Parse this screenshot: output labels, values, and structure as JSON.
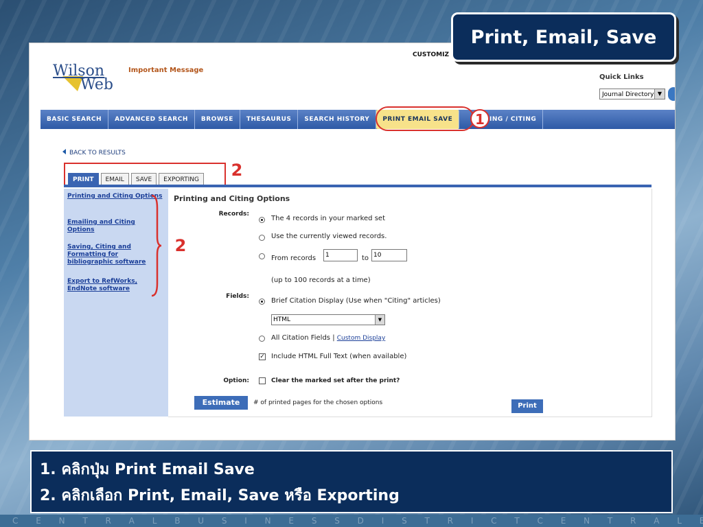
{
  "slide": {
    "title": "Print, Email, Save",
    "caption_lines": [
      "1. คลิกปุ่ม Print Email Save",
      "2. คลิกเลือก Print, Email, Save หรือ Exporting"
    ],
    "bottom_strip": "C E N T R A L B U S I N E S S D I S T R I C T C E N T R A L B U S I N E S S D I S T R I C T C E N T R A"
  },
  "header": {
    "logo_top": "Wilson",
    "logo_bottom": "Web",
    "important_message": "Important Message",
    "customize": "CUSTOMIZ",
    "quick_links_label": "Quick Links",
    "quick_links_value": "Journal Directory"
  },
  "nav": {
    "items": [
      "BASIC SEARCH",
      "ADVANCED SEARCH",
      "BROWSE",
      "THESAURUS",
      "SEARCH HISTORY",
      "PRINT EMAIL SAVE",
      "EXPORTING / CITING"
    ],
    "active_index": 5,
    "visible_partial_label": "ORTING / CITING"
  },
  "markers": {
    "one": "1",
    "two": "2"
  },
  "back_link": "BACK TO RESULTS",
  "tabs": [
    "PRINT",
    "EMAIL",
    "SAVE",
    "EXPORTING"
  ],
  "sidebar_links": [
    "Printing and Citing Options",
    "Emailing and Citing Options",
    "Saving, Citing and Formatting for bibliographic software",
    "Export to RefWorks, EndNote software"
  ],
  "content": {
    "title": "Printing and Citing Options",
    "records_label": "Records:",
    "records_opt1": "The 4 records in your marked set",
    "records_opt2": "Use the currently viewed records.",
    "records_opt3_prefix": "From records",
    "records_from": "1",
    "records_to_label": "to",
    "records_to": "10",
    "records_note": "(up to 100 records at a time)",
    "fields_label": "Fields:",
    "fields_opt1": "Brief Citation Display (Use when \"Citing\" articles)",
    "fields_format": "HTML",
    "fields_opt2": "All Citation Fields |",
    "custom_display": "Custom Display",
    "include_fulltext": "Include HTML Full Text (when available)",
    "option_label": "Option:",
    "option_text": "Clear the marked set after the print?",
    "estimate_button": "Estimate",
    "estimate_note": "# of printed pages for the chosen options",
    "print_button": "Print"
  }
}
